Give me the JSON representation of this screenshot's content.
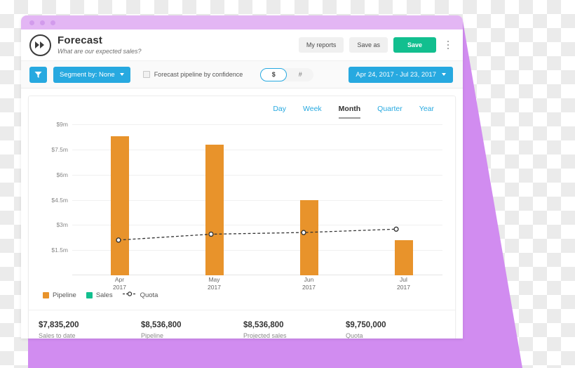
{
  "window": {
    "titlebar_dots": [
      "dot-1",
      "dot-2",
      "dot-3"
    ]
  },
  "header": {
    "logo_icon": "fast-forward-icon",
    "title": "Forecast",
    "subtitle": "What are our expected sales?",
    "buttons": [
      {
        "label": "My reports",
        "style": "secondary"
      },
      {
        "label": "Save as",
        "style": "secondary"
      },
      {
        "label": "Save",
        "style": "primary"
      }
    ],
    "overflow_icon": "kebab-menu-icon"
  },
  "toolbar": {
    "filter_icon": "funnel-icon",
    "segment_label": "Segment by: None",
    "segment_chevron": "chevron-down-icon",
    "confidence_label": "Forecast pipeline by confidence",
    "confidence_checked": false,
    "unit_options": [
      {
        "label": "$",
        "active": true
      },
      {
        "label": "#",
        "active": false
      }
    ],
    "date_range": "Apr 24, 2017 - Jul 23, 2017",
    "date_chevron": "chevron-down-icon"
  },
  "tabs": [
    {
      "label": "Day",
      "active": false
    },
    {
      "label": "Week",
      "active": false
    },
    {
      "label": "Month",
      "active": true
    },
    {
      "label": "Quarter",
      "active": false
    },
    {
      "label": "Year",
      "active": false
    }
  ],
  "legend": [
    {
      "label": "Pipeline",
      "color": "#e8932b",
      "type": "square"
    },
    {
      "label": "Sales",
      "color": "#12bf8f",
      "type": "square"
    },
    {
      "label": "Quota",
      "color": "#333333",
      "type": "dashed-line-marker"
    }
  ],
  "summary": [
    {
      "value": "$7,835,200",
      "label": "Sales to date"
    },
    {
      "value": "$8,536,800",
      "label": "Pipeline"
    },
    {
      "value": "$8,536,800",
      "label": "Projected sales"
    },
    {
      "value": "$9,750,000",
      "label": "Quota"
    }
  ],
  "colors": {
    "orange": "#e8932b",
    "green": "#12bf8f",
    "blue": "#27a9e0",
    "purple": "#d18cf0",
    "titlebar": "#e3b6f4"
  },
  "chart_data": {
    "type": "bar",
    "title": "",
    "xlabel": "",
    "ylabel": "",
    "categories": [
      "Apr\n2017",
      "May\n2017",
      "Jun\n2017",
      "Jul\n2017"
    ],
    "category_lines": [
      [
        "Apr",
        "2017"
      ],
      [
        "May",
        "2017"
      ],
      [
        "Jun",
        "2017"
      ],
      [
        "Jul",
        "2017"
      ]
    ],
    "ylim": [
      0,
      9
    ],
    "yticks": [
      1.5,
      3,
      4.5,
      6,
      7.5,
      9
    ],
    "ytick_labels": [
      "$1.5m",
      "$3m",
      "$4.5m",
      "$6m",
      "$7.5m",
      "$9m"
    ],
    "grid": true,
    "legend_position": "bottom-left",
    "series": [
      {
        "name": "Pipeline",
        "type": "bar",
        "color": "#e8932b",
        "values": [
          8.3,
          7.8,
          4.5,
          2.1
        ]
      },
      {
        "name": "Sales",
        "type": "bar",
        "color": "#12bf8f",
        "values": [
          0,
          0,
          0,
          0
        ]
      },
      {
        "name": "Quota",
        "type": "line",
        "color": "#333333",
        "style": "dashed",
        "marker": "circle",
        "values": [
          2.1,
          2.45,
          2.55,
          2.75
        ]
      }
    ]
  }
}
